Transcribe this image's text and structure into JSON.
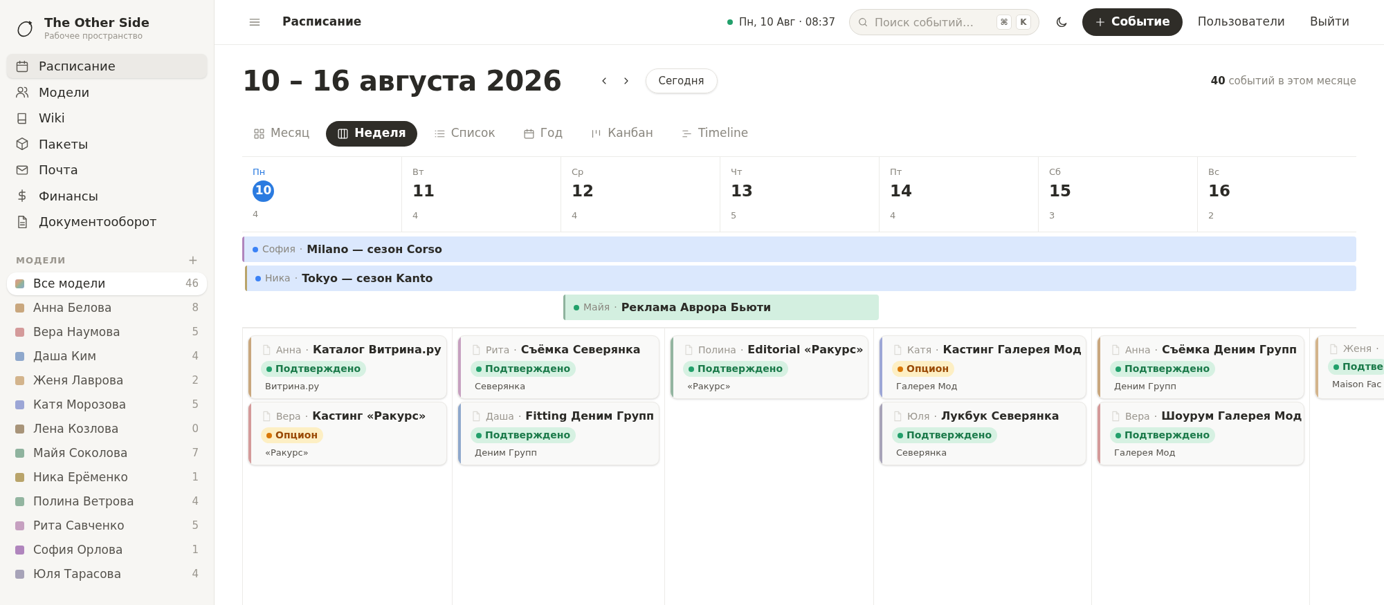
{
  "workspace": {
    "name": "The Other Side",
    "subtitle": "Рабочее пространство"
  },
  "nav": [
    {
      "label": "Расписание",
      "selected": true
    },
    {
      "label": "Модели",
      "selected": false
    },
    {
      "label": "Wiki",
      "selected": false
    },
    {
      "label": "Пакеты",
      "selected": false
    },
    {
      "label": "Почта",
      "selected": false
    },
    {
      "label": "Финансы",
      "selected": false
    },
    {
      "label": "Документооборот",
      "selected": false
    }
  ],
  "models_section": {
    "title": "МОДЕЛИ",
    "add": "+"
  },
  "models": [
    {
      "name": "Все модели",
      "count": "46",
      "selected": true
    },
    {
      "name": "Анна Белова",
      "count": "8",
      "selected": false,
      "color": "#c9a77e"
    },
    {
      "name": "Вера Наумова",
      "count": "5",
      "selected": false,
      "color": "#d49a9a"
    },
    {
      "name": "Даша Ким",
      "count": "4",
      "selected": false,
      "color": "#8fa8cc"
    },
    {
      "name": "Женя Лаврова",
      "count": "2",
      "selected": false,
      "color": "#d3b48c"
    },
    {
      "name": "Катя Морозова",
      "count": "5",
      "selected": false,
      "color": "#9ca6d6"
    },
    {
      "name": "Лена Козлова",
      "count": "0",
      "selected": false,
      "color": "#a89479"
    },
    {
      "name": "Майя Соколова",
      "count": "7",
      "selected": false,
      "color": "#8fb39e"
    },
    {
      "name": "Ника Ерёменко",
      "count": "1",
      "selected": false,
      "color": "#b9a46a"
    },
    {
      "name": "Полина Ветрова",
      "count": "4",
      "selected": false,
      "color": "#93b5a0"
    },
    {
      "name": "Рита Савченко",
      "count": "5",
      "selected": false,
      "color": "#c6a0c0"
    },
    {
      "name": "София Орлова",
      "count": "1",
      "selected": false,
      "color": "#b085bd"
    },
    {
      "name": "Юля Тарасова",
      "count": "4",
      "selected": false,
      "color": "#a7a3b8"
    }
  ],
  "topbar": {
    "title": "Расписание",
    "datetime": "Пн, 10 Авг · 08:37",
    "search_placeholder": "Поиск событий…",
    "shortcut": [
      "⌘",
      "K"
    ],
    "new_event": "Событие",
    "links": [
      "Пользователи",
      "Выйти"
    ]
  },
  "heading": {
    "title": "10 – 16 августа 2026",
    "today": "Сегодня",
    "summary": "**40** событий в этом месяце"
  },
  "views": [
    {
      "label": "Месяц",
      "selected": false
    },
    {
      "label": "Неделя",
      "selected": true
    },
    {
      "label": "Список",
      "selected": false
    },
    {
      "label": "Год",
      "selected": false
    },
    {
      "label": "Канбан",
      "selected": false
    },
    {
      "label": "Timeline",
      "selected": false
    }
  ],
  "days": [
    {
      "weekday": "Пн",
      "date": "10",
      "count": "4",
      "today": true
    },
    {
      "weekday": "Вт",
      "date": "11",
      "count": "4",
      "today": false
    },
    {
      "weekday": "Ср",
      "date": "12",
      "count": "4",
      "today": false
    },
    {
      "weekday": "Чт",
      "date": "13",
      "count": "5",
      "today": false
    },
    {
      "weekday": "Пт",
      "date": "14",
      "count": "4",
      "today": false
    },
    {
      "weekday": "Сб",
      "date": "15",
      "count": "3",
      "today": false
    },
    {
      "weekday": "Вс",
      "date": "16",
      "count": "2",
      "today": false
    }
  ],
  "multi_day_events": [
    {
      "model": "София",
      "separator": "·",
      "title": "Milano — сезон Corso",
      "kind": "trip",
      "color": "#b085bd"
    },
    {
      "model": "Ника",
      "separator": "·",
      "title": "Tokyo — сезон Kanto",
      "kind": "trip",
      "color": "#b9a46a"
    },
    {
      "model": "Майя",
      "separator": "·",
      "title": "Реклама Аврора Бьюти",
      "kind": "job",
      "color": "#8fb39e"
    }
  ],
  "columns": [
    [
      {
        "model": "Анна",
        "separator": "·",
        "title": "Каталог Витрина.ру",
        "status": "Подтверждено",
        "kind": "confirmed",
        "client": "Витрина.ру",
        "color": "#c9a77e"
      },
      {
        "model": "Вера",
        "separator": "·",
        "title": "Кастинг «Ракурс»",
        "status": "Опцион",
        "kind": "option",
        "client": "«Ракурс»",
        "color": "#d49a9a"
      }
    ],
    [
      {
        "model": "Рита",
        "separator": "·",
        "title": "Съёмка Северянка",
        "status": "Подтверждено",
        "kind": "confirmed",
        "client": "Северянка",
        "color": "#c6a0c0"
      },
      {
        "model": "Даша",
        "separator": "·",
        "title": "Fitting Деним Групп",
        "status": "Подтверждено",
        "kind": "confirmed",
        "client": "Деним Групп",
        "color": "#8fa8cc"
      }
    ],
    [
      {
        "model": "Полина",
        "separator": "·",
        "title": "Editorial «Ракурс»",
        "status": "Подтверждено",
        "kind": "confirmed",
        "client": "«Ракурс»",
        "color": "#93b5a0"
      }
    ],
    [
      {
        "model": "Катя",
        "separator": "·",
        "title": "Кастинг Галерея Мод",
        "status": "Опцион",
        "kind": "option",
        "client": "Галерея Мод",
        "color": "#9ca6d6"
      },
      {
        "model": "Юля",
        "separator": "·",
        "title": "Лукбук Северянка",
        "status": "Подтверждено",
        "kind": "confirmed",
        "client": "Северянка",
        "color": "#a7a3b8"
      }
    ],
    [
      {
        "model": "Анна",
        "separator": "·",
        "title": "Съёмка Деним Групп",
        "status": "Подтверждено",
        "kind": "confirmed",
        "client": "Деним Групп",
        "color": "#c9a77e"
      },
      {
        "model": "Вера",
        "separator": "·",
        "title": "Шоурум Галерея Мод",
        "status": "Подтверждено",
        "kind": "confirmed",
        "client": "Галерея Мод",
        "color": "#d49a9a"
      }
    ],
    [
      {
        "model": "Женя",
        "separator": "·",
        "status": "Подтве",
        "kind": "confirmed",
        "client": "Maison Fac",
        "color": "#d3b48c"
      }
    ]
  ]
}
